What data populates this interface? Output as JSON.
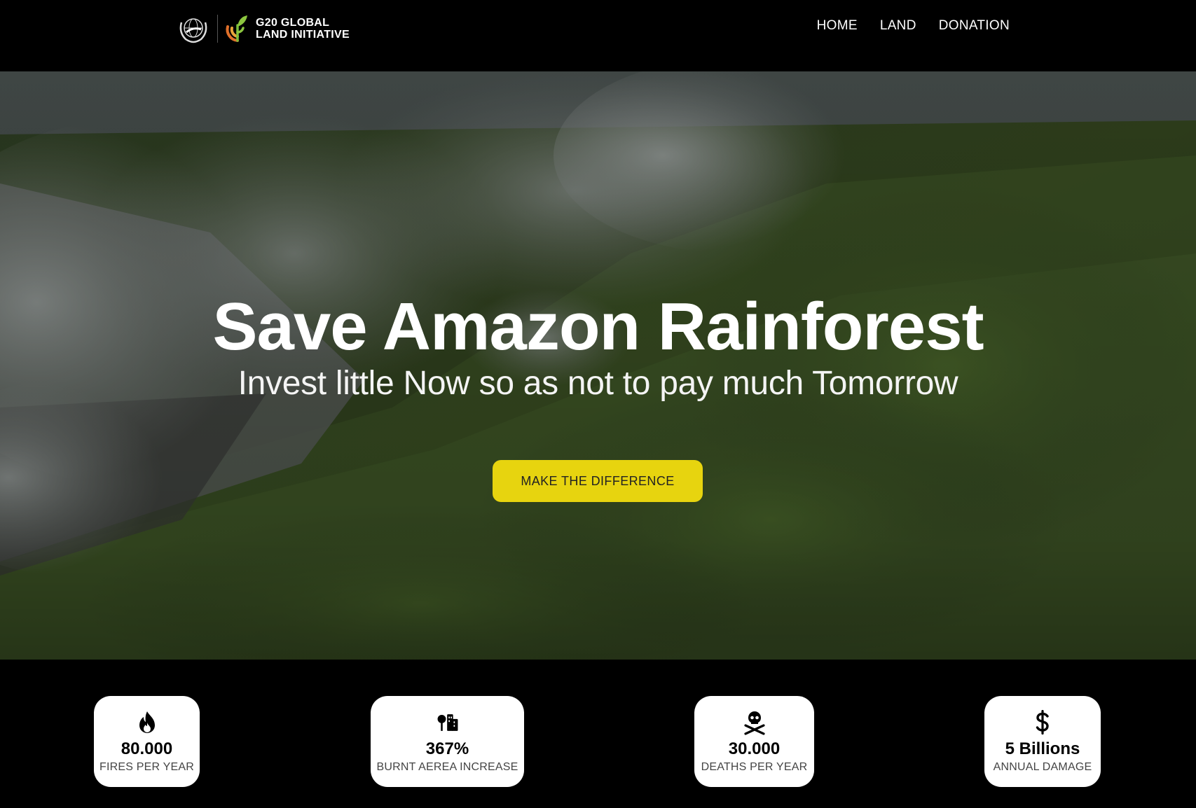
{
  "header": {
    "brand_line1": "G20 GLOBAL",
    "brand_line2": "LAND INITIATIVE",
    "nav": [
      "HOME",
      "LAND",
      "DONATION"
    ]
  },
  "hero": {
    "title": "Save Amazon Rainforest",
    "subtitle": "Invest little Now so as not to pay much Tomorrow",
    "cta_label": "MAKE THE DIFFERENCE"
  },
  "stats": [
    {
      "icon": "fire-icon",
      "value": "80.000",
      "label": "FIRES PER YEAR"
    },
    {
      "icon": "tree-building-icon",
      "value": "367%",
      "label": "BURNT AEREA INCREASE"
    },
    {
      "icon": "skull-crossbones-icon",
      "value": "30.000",
      "label": "DEATHS PER YEAR"
    },
    {
      "icon": "dollar-icon",
      "value": "5 Billions",
      "label": "ANNUAL DAMAGE"
    }
  ],
  "colors": {
    "cta": "#e7d40f",
    "background": "#000000",
    "card": "#ffffff"
  }
}
